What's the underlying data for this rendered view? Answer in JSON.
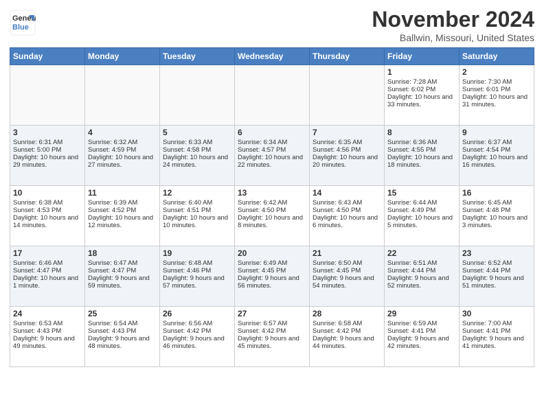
{
  "logo": {
    "line1": "General",
    "line2": "Blue"
  },
  "title": "November 2024",
  "location": "Ballwin, Missouri, United States",
  "days_of_week": [
    "Sunday",
    "Monday",
    "Tuesday",
    "Wednesday",
    "Thursday",
    "Friday",
    "Saturday"
  ],
  "weeks": [
    [
      {
        "day": "",
        "info": ""
      },
      {
        "day": "",
        "info": ""
      },
      {
        "day": "",
        "info": ""
      },
      {
        "day": "",
        "info": ""
      },
      {
        "day": "",
        "info": ""
      },
      {
        "day": "1",
        "info": "Sunrise: 7:28 AM\nSunset: 6:02 PM\nDaylight: 10 hours and 33 minutes."
      },
      {
        "day": "2",
        "info": "Sunrise: 7:30 AM\nSunset: 6:01 PM\nDaylight: 10 hours and 31 minutes."
      }
    ],
    [
      {
        "day": "3",
        "info": "Sunrise: 6:31 AM\nSunset: 5:00 PM\nDaylight: 10 hours and 29 minutes."
      },
      {
        "day": "4",
        "info": "Sunrise: 6:32 AM\nSunset: 4:59 PM\nDaylight: 10 hours and 27 minutes."
      },
      {
        "day": "5",
        "info": "Sunrise: 6:33 AM\nSunset: 4:58 PM\nDaylight: 10 hours and 24 minutes."
      },
      {
        "day": "6",
        "info": "Sunrise: 6:34 AM\nSunset: 4:57 PM\nDaylight: 10 hours and 22 minutes."
      },
      {
        "day": "7",
        "info": "Sunrise: 6:35 AM\nSunset: 4:56 PM\nDaylight: 10 hours and 20 minutes."
      },
      {
        "day": "8",
        "info": "Sunrise: 6:36 AM\nSunset: 4:55 PM\nDaylight: 10 hours and 18 minutes."
      },
      {
        "day": "9",
        "info": "Sunrise: 6:37 AM\nSunset: 4:54 PM\nDaylight: 10 hours and 16 minutes."
      }
    ],
    [
      {
        "day": "10",
        "info": "Sunrise: 6:38 AM\nSunset: 4:53 PM\nDaylight: 10 hours and 14 minutes."
      },
      {
        "day": "11",
        "info": "Sunrise: 6:39 AM\nSunset: 4:52 PM\nDaylight: 10 hours and 12 minutes."
      },
      {
        "day": "12",
        "info": "Sunrise: 6:40 AM\nSunset: 4:51 PM\nDaylight: 10 hours and 10 minutes."
      },
      {
        "day": "13",
        "info": "Sunrise: 6:42 AM\nSunset: 4:50 PM\nDaylight: 10 hours and 8 minutes."
      },
      {
        "day": "14",
        "info": "Sunrise: 6:43 AM\nSunset: 4:50 PM\nDaylight: 10 hours and 6 minutes."
      },
      {
        "day": "15",
        "info": "Sunrise: 6:44 AM\nSunset: 4:49 PM\nDaylight: 10 hours and 5 minutes."
      },
      {
        "day": "16",
        "info": "Sunrise: 6:45 AM\nSunset: 4:48 PM\nDaylight: 10 hours and 3 minutes."
      }
    ],
    [
      {
        "day": "17",
        "info": "Sunrise: 6:46 AM\nSunset: 4:47 PM\nDaylight: 10 hours and 1 minute."
      },
      {
        "day": "18",
        "info": "Sunrise: 6:47 AM\nSunset: 4:47 PM\nDaylight: 9 hours and 59 minutes."
      },
      {
        "day": "19",
        "info": "Sunrise: 6:48 AM\nSunset: 4:46 PM\nDaylight: 9 hours and 57 minutes."
      },
      {
        "day": "20",
        "info": "Sunrise: 6:49 AM\nSunset: 4:45 PM\nDaylight: 9 hours and 56 minutes."
      },
      {
        "day": "21",
        "info": "Sunrise: 6:50 AM\nSunset: 4:45 PM\nDaylight: 9 hours and 54 minutes."
      },
      {
        "day": "22",
        "info": "Sunrise: 6:51 AM\nSunset: 4:44 PM\nDaylight: 9 hours and 52 minutes."
      },
      {
        "day": "23",
        "info": "Sunrise: 6:52 AM\nSunset: 4:44 PM\nDaylight: 9 hours and 51 minutes."
      }
    ],
    [
      {
        "day": "24",
        "info": "Sunrise: 6:53 AM\nSunset: 4:43 PM\nDaylight: 9 hours and 49 minutes."
      },
      {
        "day": "25",
        "info": "Sunrise: 6:54 AM\nSunset: 4:43 PM\nDaylight: 9 hours and 48 minutes."
      },
      {
        "day": "26",
        "info": "Sunrise: 6:56 AM\nSunset: 4:42 PM\nDaylight: 9 hours and 46 minutes."
      },
      {
        "day": "27",
        "info": "Sunrise: 6:57 AM\nSunset: 4:42 PM\nDaylight: 9 hours and 45 minutes."
      },
      {
        "day": "28",
        "info": "Sunrise: 6:58 AM\nSunset: 4:42 PM\nDaylight: 9 hours and 44 minutes."
      },
      {
        "day": "29",
        "info": "Sunrise: 6:59 AM\nSunset: 4:41 PM\nDaylight: 9 hours and 42 minutes."
      },
      {
        "day": "30",
        "info": "Sunrise: 7:00 AM\nSunset: 4:41 PM\nDaylight: 9 hours and 41 minutes."
      }
    ]
  ]
}
